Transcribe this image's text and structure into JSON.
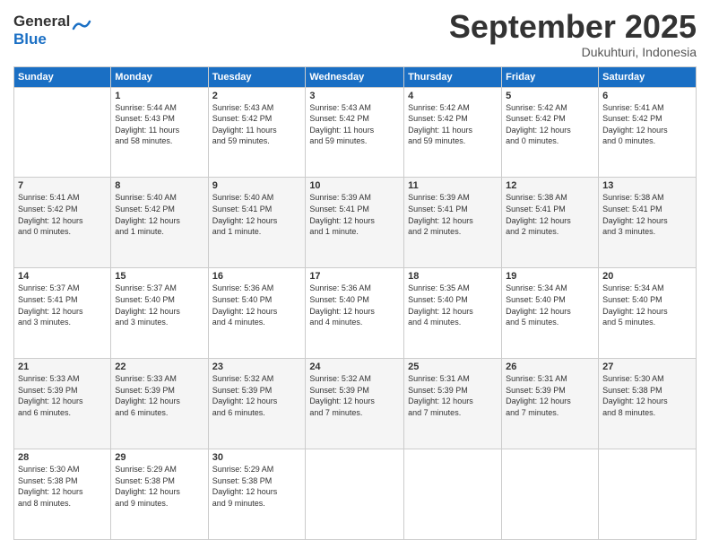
{
  "header": {
    "logo_line1": "General",
    "logo_line2": "Blue",
    "month": "September 2025",
    "location": "Dukuhturi, Indonesia"
  },
  "days_of_week": [
    "Sunday",
    "Monday",
    "Tuesday",
    "Wednesday",
    "Thursday",
    "Friday",
    "Saturday"
  ],
  "weeks": [
    [
      {
        "day": "",
        "info": ""
      },
      {
        "day": "1",
        "info": "Sunrise: 5:44 AM\nSunset: 5:43 PM\nDaylight: 11 hours\nand 58 minutes."
      },
      {
        "day": "2",
        "info": "Sunrise: 5:43 AM\nSunset: 5:42 PM\nDaylight: 11 hours\nand 59 minutes."
      },
      {
        "day": "3",
        "info": "Sunrise: 5:43 AM\nSunset: 5:42 PM\nDaylight: 11 hours\nand 59 minutes."
      },
      {
        "day": "4",
        "info": "Sunrise: 5:42 AM\nSunset: 5:42 PM\nDaylight: 11 hours\nand 59 minutes."
      },
      {
        "day": "5",
        "info": "Sunrise: 5:42 AM\nSunset: 5:42 PM\nDaylight: 12 hours\nand 0 minutes."
      },
      {
        "day": "6",
        "info": "Sunrise: 5:41 AM\nSunset: 5:42 PM\nDaylight: 12 hours\nand 0 minutes."
      }
    ],
    [
      {
        "day": "7",
        "info": "Sunrise: 5:41 AM\nSunset: 5:42 PM\nDaylight: 12 hours\nand 0 minutes."
      },
      {
        "day": "8",
        "info": "Sunrise: 5:40 AM\nSunset: 5:42 PM\nDaylight: 12 hours\nand 1 minute."
      },
      {
        "day": "9",
        "info": "Sunrise: 5:40 AM\nSunset: 5:41 PM\nDaylight: 12 hours\nand 1 minute."
      },
      {
        "day": "10",
        "info": "Sunrise: 5:39 AM\nSunset: 5:41 PM\nDaylight: 12 hours\nand 1 minute."
      },
      {
        "day": "11",
        "info": "Sunrise: 5:39 AM\nSunset: 5:41 PM\nDaylight: 12 hours\nand 2 minutes."
      },
      {
        "day": "12",
        "info": "Sunrise: 5:38 AM\nSunset: 5:41 PM\nDaylight: 12 hours\nand 2 minutes."
      },
      {
        "day": "13",
        "info": "Sunrise: 5:38 AM\nSunset: 5:41 PM\nDaylight: 12 hours\nand 3 minutes."
      }
    ],
    [
      {
        "day": "14",
        "info": "Sunrise: 5:37 AM\nSunset: 5:41 PM\nDaylight: 12 hours\nand 3 minutes."
      },
      {
        "day": "15",
        "info": "Sunrise: 5:37 AM\nSunset: 5:40 PM\nDaylight: 12 hours\nand 3 minutes."
      },
      {
        "day": "16",
        "info": "Sunrise: 5:36 AM\nSunset: 5:40 PM\nDaylight: 12 hours\nand 4 minutes."
      },
      {
        "day": "17",
        "info": "Sunrise: 5:36 AM\nSunset: 5:40 PM\nDaylight: 12 hours\nand 4 minutes."
      },
      {
        "day": "18",
        "info": "Sunrise: 5:35 AM\nSunset: 5:40 PM\nDaylight: 12 hours\nand 4 minutes."
      },
      {
        "day": "19",
        "info": "Sunrise: 5:34 AM\nSunset: 5:40 PM\nDaylight: 12 hours\nand 5 minutes."
      },
      {
        "day": "20",
        "info": "Sunrise: 5:34 AM\nSunset: 5:40 PM\nDaylight: 12 hours\nand 5 minutes."
      }
    ],
    [
      {
        "day": "21",
        "info": "Sunrise: 5:33 AM\nSunset: 5:39 PM\nDaylight: 12 hours\nand 6 minutes."
      },
      {
        "day": "22",
        "info": "Sunrise: 5:33 AM\nSunset: 5:39 PM\nDaylight: 12 hours\nand 6 minutes."
      },
      {
        "day": "23",
        "info": "Sunrise: 5:32 AM\nSunset: 5:39 PM\nDaylight: 12 hours\nand 6 minutes."
      },
      {
        "day": "24",
        "info": "Sunrise: 5:32 AM\nSunset: 5:39 PM\nDaylight: 12 hours\nand 7 minutes."
      },
      {
        "day": "25",
        "info": "Sunrise: 5:31 AM\nSunset: 5:39 PM\nDaylight: 12 hours\nand 7 minutes."
      },
      {
        "day": "26",
        "info": "Sunrise: 5:31 AM\nSunset: 5:39 PM\nDaylight: 12 hours\nand 7 minutes."
      },
      {
        "day": "27",
        "info": "Sunrise: 5:30 AM\nSunset: 5:38 PM\nDaylight: 12 hours\nand 8 minutes."
      }
    ],
    [
      {
        "day": "28",
        "info": "Sunrise: 5:30 AM\nSunset: 5:38 PM\nDaylight: 12 hours\nand 8 minutes."
      },
      {
        "day": "29",
        "info": "Sunrise: 5:29 AM\nSunset: 5:38 PM\nDaylight: 12 hours\nand 9 minutes."
      },
      {
        "day": "30",
        "info": "Sunrise: 5:29 AM\nSunset: 5:38 PM\nDaylight: 12 hours\nand 9 minutes."
      },
      {
        "day": "",
        "info": ""
      },
      {
        "day": "",
        "info": ""
      },
      {
        "day": "",
        "info": ""
      },
      {
        "day": "",
        "info": ""
      }
    ]
  ]
}
